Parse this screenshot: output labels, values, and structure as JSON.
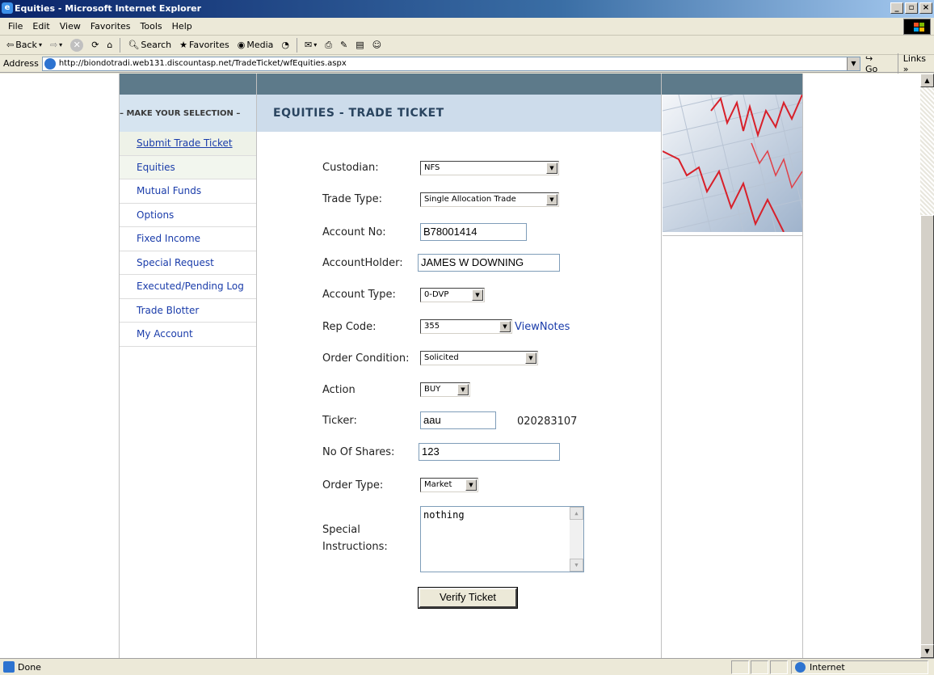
{
  "window": {
    "title": "Equities - Microsoft Internet Explorer"
  },
  "menu": [
    "File",
    "Edit",
    "View",
    "Favorites",
    "Tools",
    "Help"
  ],
  "toolbar": {
    "back": "Back",
    "search": "Search",
    "favorites": "Favorites",
    "media": "Media"
  },
  "address": {
    "label": "Address",
    "url": "http://biondotradi.web131.discountasp.net/TradeTicket/wfEquities.aspx",
    "go": "Go",
    "links": "Links"
  },
  "sidebar": {
    "header": "– MAKE YOUR SELECTION –",
    "items": [
      {
        "label": "Submit Trade Ticket"
      },
      {
        "label": "Equities"
      },
      {
        "label": "Mutual Funds"
      },
      {
        "label": "Options"
      },
      {
        "label": "Fixed Income"
      },
      {
        "label": "Special Request"
      },
      {
        "label": "Executed/Pending Log"
      },
      {
        "label": "Trade Blotter"
      },
      {
        "label": "My Account"
      }
    ]
  },
  "page": {
    "title": "EQUITIES - TRADE TICKET"
  },
  "form": {
    "custodian_label": "Custodian:",
    "custodian_value": "NFS",
    "trade_type_label": "Trade Type:",
    "trade_type_value": "Single Allocation Trade",
    "account_no_label": "Account No:",
    "account_no_value": "B78001414",
    "account_holder_label": "AccountHolder:",
    "account_holder_value": "JAMES W DOWNING",
    "account_type_label": "Account Type:",
    "account_type_value": "0-DVP",
    "rep_code_label": "Rep Code:",
    "rep_code_value": "355",
    "view_notes": "ViewNotes",
    "order_condition_label": "Order Condition:",
    "order_condition_value": "Solicited",
    "action_label": "Action",
    "action_value": "BUY",
    "ticker_label": "Ticker:",
    "ticker_value": "aau",
    "cusip": "020283107",
    "shares_label": "No Of Shares:",
    "shares_value": "123",
    "order_type_label": "Order Type:",
    "order_type_value": "Market",
    "special_label_1": "Special",
    "special_label_2": "Instructions:",
    "special_value": "nothing",
    "verify_button": "Verify Ticket"
  },
  "status": {
    "text": "Done",
    "zone": "Internet"
  }
}
